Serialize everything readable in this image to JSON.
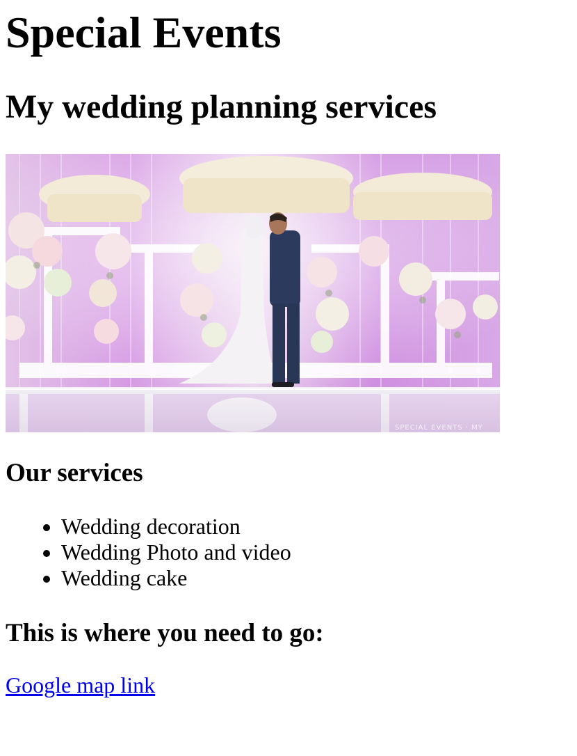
{
  "header": {
    "title": "Special Events",
    "subtitle": "My wedding planning services"
  },
  "hero": {
    "watermark": "SPECIAL EVENTS · MY",
    "accent_color": "#c98ee0"
  },
  "services": {
    "heading": "Our services",
    "items": [
      "Wedding decoration",
      "Wedding Photo and video",
      "Wedding cake"
    ]
  },
  "location": {
    "heading": "This is where you need to go:",
    "link_label": "Google map link",
    "link_color": "#0000ee"
  }
}
